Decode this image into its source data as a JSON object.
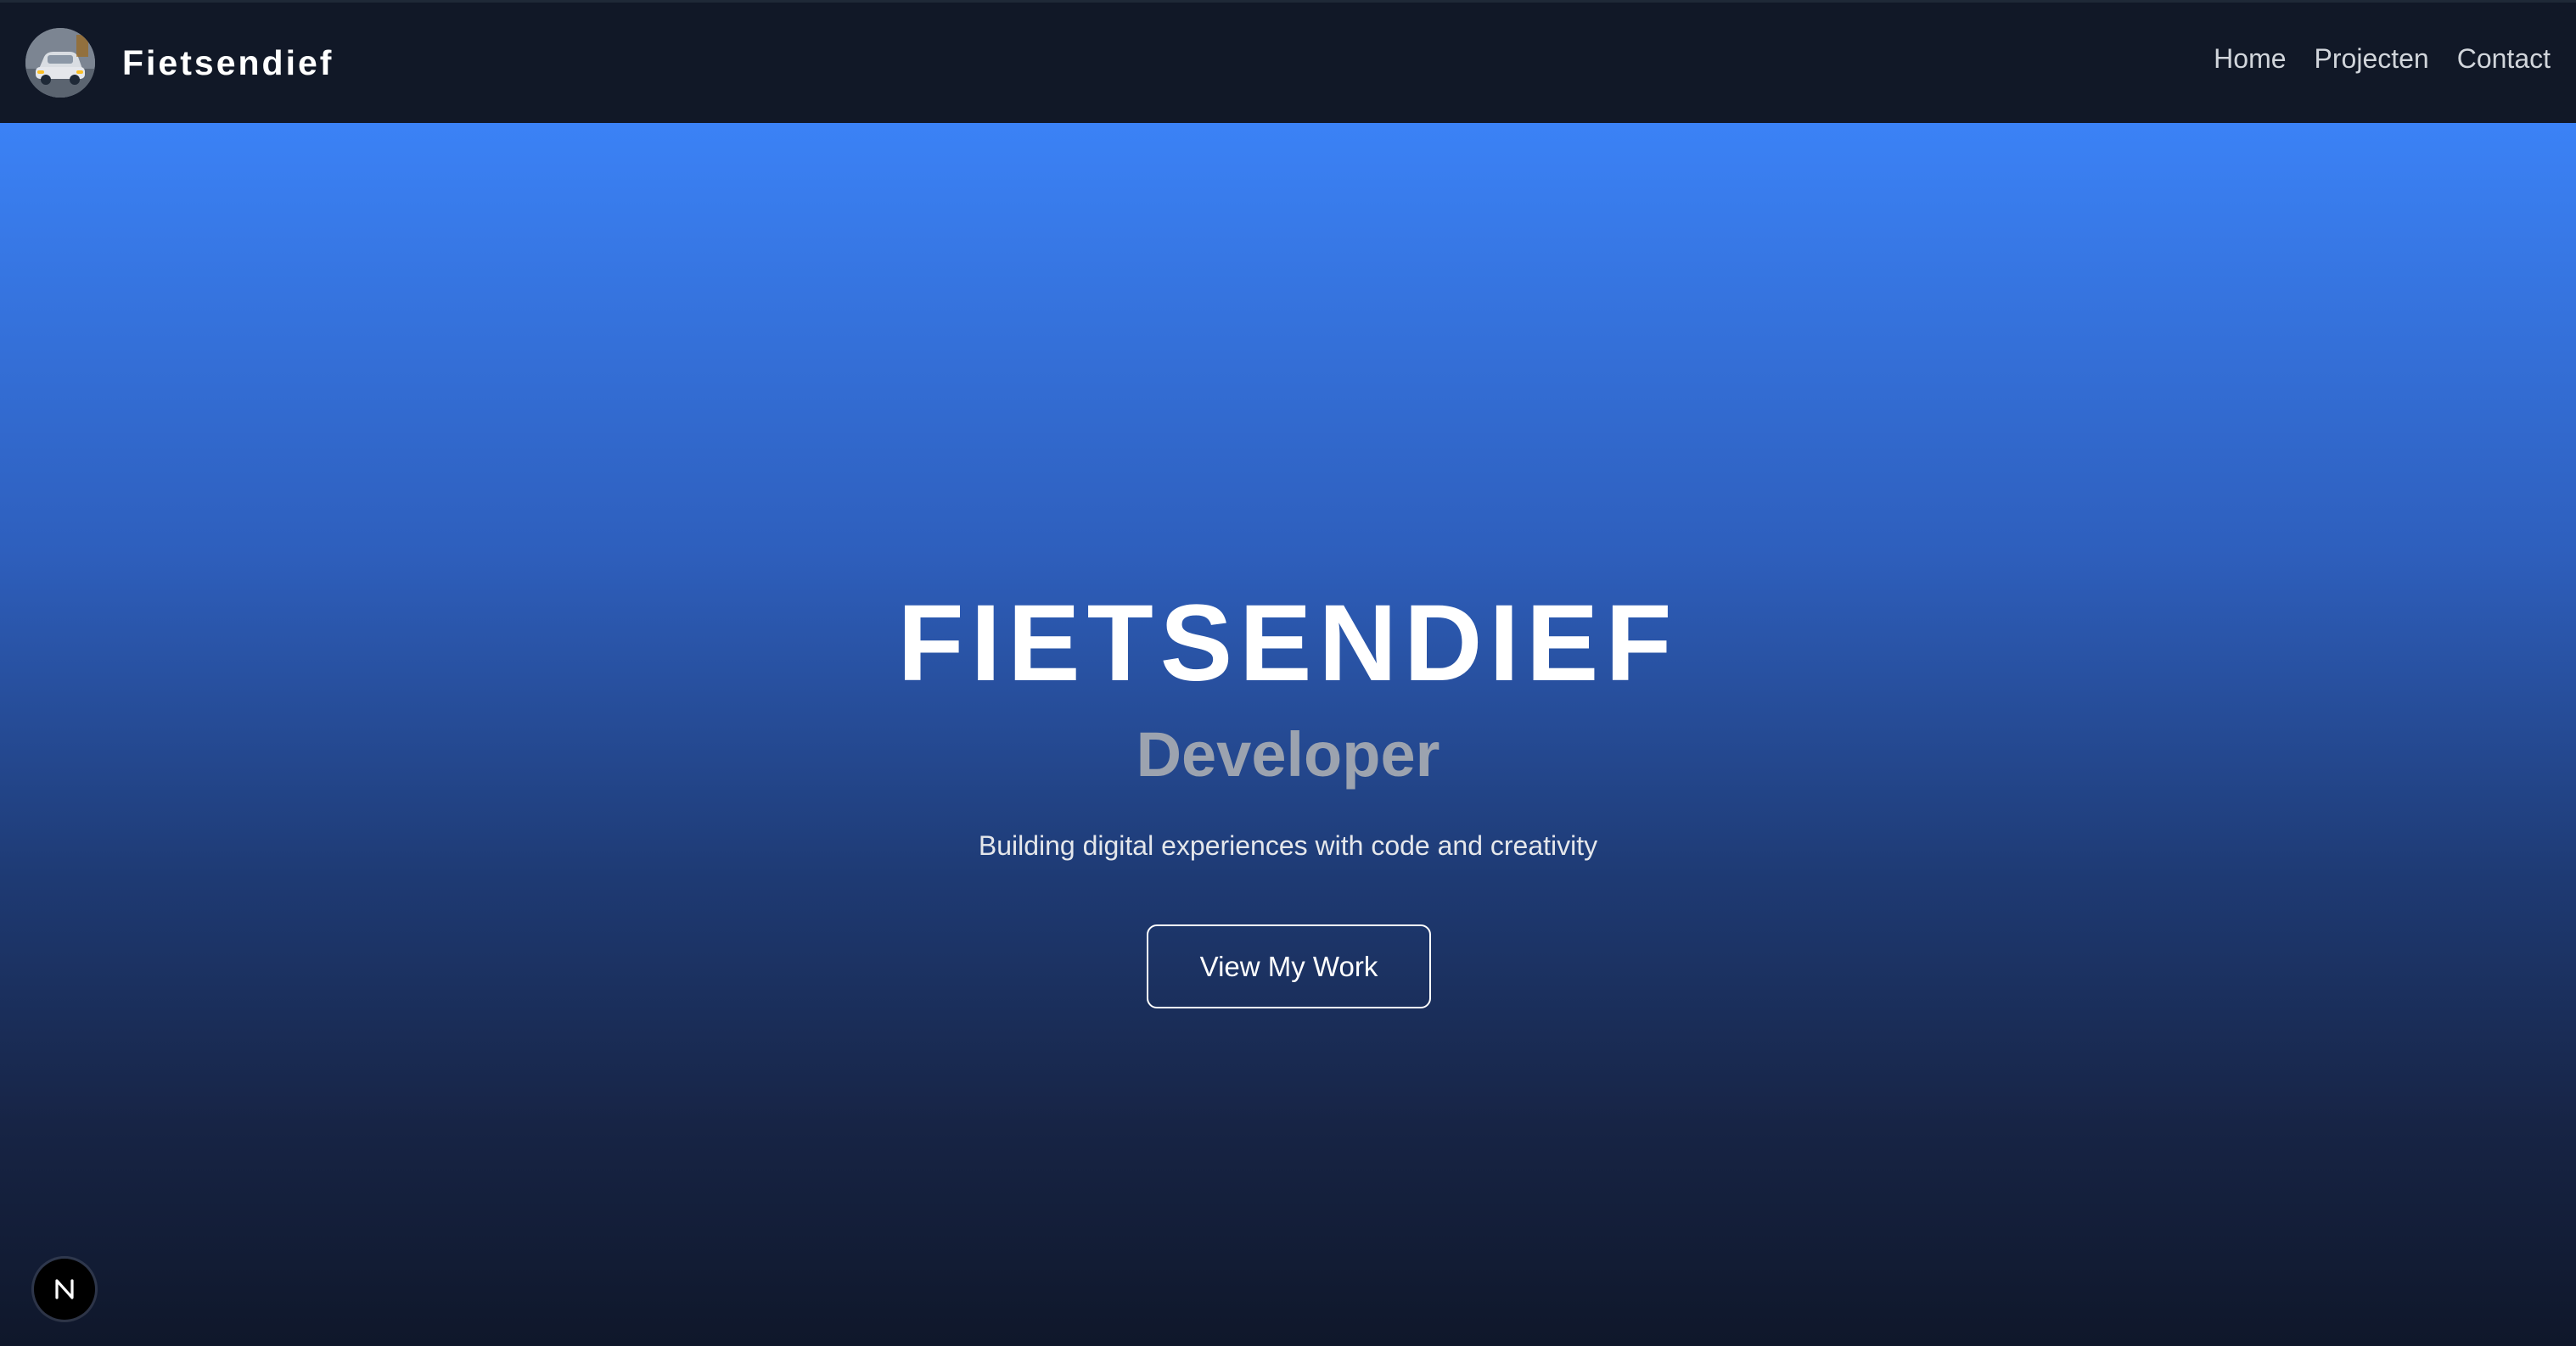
{
  "header": {
    "brand_name": "Fietsendief",
    "avatar_icon": "car-photo-avatar",
    "nav": [
      {
        "label": "Home"
      },
      {
        "label": "Projecten"
      },
      {
        "label": "Contact"
      }
    ]
  },
  "hero": {
    "title": "FIETSENDIEF",
    "subtitle": "Developer",
    "tagline": "Building digital experiences with code and creativity",
    "cta_label": "View My Work"
  },
  "dev_badge": {
    "icon": "nextjs-n-icon"
  },
  "colors": {
    "header_bg": "#111827",
    "gradient_top": "#3b82f6",
    "gradient_bottom": "#0f172a",
    "subtitle": "#9ca3af"
  }
}
